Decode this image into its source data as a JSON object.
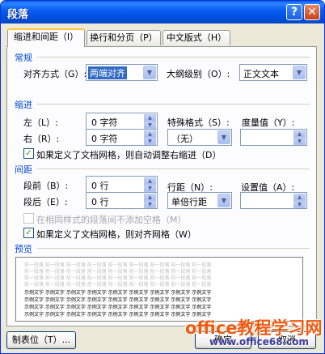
{
  "window": {
    "title": "段落",
    "help_glyph": "?",
    "close_glyph": "✕"
  },
  "tabs": [
    {
      "label": "缩进和间距（I）"
    },
    {
      "label": "换行和分页（P）"
    },
    {
      "label": "中文版式（H）"
    }
  ],
  "general": {
    "section": "常规",
    "alignment_label": "对齐方式（G）:",
    "alignment_value": "两端对齐",
    "outline_label": "大纲级别（O）:",
    "outline_value": "正文文本"
  },
  "indent": {
    "section": "缩进",
    "left_label": "左（L）:",
    "left_value": "0 字符",
    "right_label": "右（R）:",
    "right_value": "0 字符",
    "special_label": "特殊格式（S）:",
    "special_value": "（无）",
    "measure_label": "度量值（Y）:",
    "measure_value": "",
    "auto_adjust_label": "如果定义了文档网格，则自动调整右缩进（D）",
    "auto_adjust_checked": true
  },
  "spacing": {
    "section": "间距",
    "before_label": "段前（B）:",
    "before_value": "0 行",
    "after_label": "段后（E）:",
    "after_value": "0 行",
    "line_spacing_label": "行距（N）:",
    "line_spacing_value": "单倍行距",
    "set_value_label": "设置值（A）:",
    "set_value": "",
    "no_space_same_style_label": "在相同样式的段落间不添加空格（M）",
    "no_space_same_style_checked": false,
    "snap_to_grid_label": "如果定义了文档网格，则对齐网格（W）",
    "snap_to_grid_checked": true
  },
  "preview": {
    "section": "预览",
    "gray_line": "前一段落 前一段落 前一段落 前一段落 前一段落 前一段落 前一段落 前一段落 前一段落",
    "sample_line": "示例文字 示例文字 示例文字 示例文字 示例文字 示例文字 示例文字 示例文字 示例文字"
  },
  "buttons": {
    "tabs": "制表位（T）...",
    "ok": "确定",
    "cancel": "取消"
  },
  "watermark": {
    "line1": "office教程学习网",
    "line2": "www.office68.com"
  },
  "colors": {
    "title_bar": "#0a5fe6",
    "section_label": "#0046d5",
    "watermark": "#f05a0f"
  }
}
